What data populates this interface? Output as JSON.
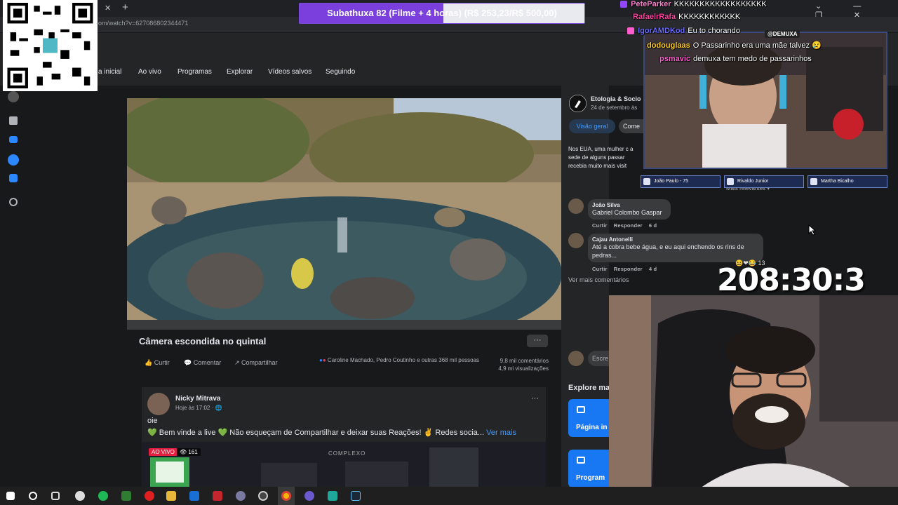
{
  "browser": {
    "url": "om/watch?v=627086802344471",
    "tab_close": "✕",
    "tab_new": "+",
    "window_controls": "⌄ — ❐ ✕"
  },
  "subathon": {
    "text": "Subathuxa 82 (Filme + 4 horas) (R$ 253,23/R$ 500,00)",
    "progress": 0.506,
    "fill_color": "#7a3fdc"
  },
  "fb_nav": {
    "tabs": [
      "a inicial",
      "Ao vivo",
      "Programas",
      "Explorar",
      "Vídeos salvos",
      "Seguindo"
    ]
  },
  "video": {
    "title": "Câmera escondida no quintal",
    "more": "···",
    "actions": {
      "like": "Curtir",
      "comment": "Comentar",
      "share": "Compartilhar"
    },
    "reactions_text": "Caroline Machado, Pedro Coutinho e outras 368 mil pessoas",
    "comments_count": "9,8 mil comentários",
    "views": "4,9 mi visualizações"
  },
  "page_info": {
    "name": "Etologia & Socio",
    "date": "24 de setembro às",
    "tab_overview": "Visão geral",
    "tab_comments": "Come",
    "description": "Nos EUA, uma mulher c a sede de alguns passar recebia muito mais visit"
  },
  "comments": {
    "sort": "Mais relevantes ▾",
    "items": [
      {
        "name": "João Silva",
        "text": "Gabriel Colombo Gaspar",
        "like": "Curtir",
        "reply": "Responder",
        "age": "6 d"
      },
      {
        "name": "Cajau Antonelli",
        "text": "Até a cobra bebe água, e eu aqui enchendo os rins de pedras...",
        "like": "Curtir",
        "reply": "Responder",
        "age": "4 d",
        "reactions": "13"
      }
    ],
    "see_more": "Ver mais comentários",
    "write_placeholder": "Escre"
  },
  "explore": {
    "title": "Explore ma",
    "cards": [
      "Página in",
      "Program"
    ]
  },
  "post2": {
    "author": "Nicky Mitrava",
    "time": "Hoje às 17:02 · 🌐",
    "more": "···",
    "line1": "oie",
    "line2": "💚 Bem vinde a live 💚 Não esqueçam de Compartilhar e deixar suas Reações! ✌ Redes socia...",
    "see_more": "Ver mais",
    "live_badge": "AO VIVO",
    "live_viewers": "👁 161",
    "thumb_label": "COMPLEXO"
  },
  "chat": {
    "lines": [
      {
        "user": "PeteParker",
        "msg": "KKKKKKKKKKKKKKKKKK",
        "color": "#ff7fd0"
      },
      {
        "user": "RafaelrRafa",
        "msg": "KKKKKKKKKKKK",
        "color": "#ff3fa0"
      },
      {
        "user": "IgorAMDKod",
        "msg": "Eu to chorando",
        "color": "#6b6bff"
      },
      {
        "user": "dodouglaas",
        "msg": "O Passarinho era uma mãe talvez 😢",
        "color": "#ffd02a"
      },
      {
        "user": "psmavic",
        "msg": "demuxa tem medo de passarinhos",
        "color": "#ff5cd0"
      }
    ]
  },
  "overlay": {
    "cam_tag": "@DEMUXA",
    "mods": [
      "João Paulo - 75",
      "Rivaldo Junior",
      "Martha Bicalho"
    ],
    "timer": "208:30:3",
    "timer_reactions": "😆❤😂 13"
  }
}
